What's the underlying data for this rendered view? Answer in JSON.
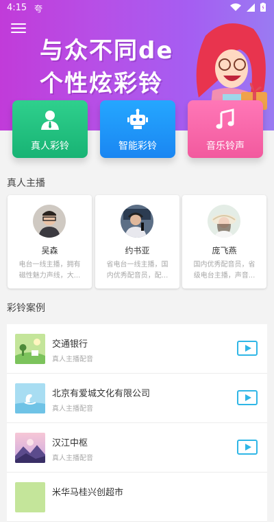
{
  "status": {
    "time": "4:15",
    "notif_icon": "夸"
  },
  "banner": {
    "line1": "与众不同de",
    "line2": "个性炫彩铃"
  },
  "features": [
    {
      "label": "真人彩铃",
      "icon": "person-icon"
    },
    {
      "label": "智能彩铃",
      "icon": "robot-icon"
    },
    {
      "label": "音乐铃声",
      "icon": "music-note-icon"
    }
  ],
  "hosts_section": {
    "title": "真人主播"
  },
  "hosts": [
    {
      "name": "吴森",
      "desc1": "电台一线主播，拥有",
      "desc2": "磁性魅力声线，大..."
    },
    {
      "name": "约书亚",
      "desc1": "省电台一线主播，国",
      "desc2": "内优秀配音员，配..."
    },
    {
      "name": "庞飞燕",
      "desc1": "国内优秀配音员，省",
      "desc2": "级电台主播，声音..."
    }
  ],
  "cases_section": {
    "title": "彩铃案例"
  },
  "cases": [
    {
      "title": "交通银行",
      "sub": "真人主播配音"
    },
    {
      "title": "北京有爱城文化有限公司",
      "sub": "真人主播配音"
    },
    {
      "title": "汉江中枢",
      "sub": "真人主播配音"
    },
    {
      "title": "米华马桂兴创超市",
      "sub": ""
    }
  ],
  "colors": {
    "accent": "#2fb6e6",
    "banner_start": "#c13bd9",
    "banner_end": "#9a7bf2"
  }
}
